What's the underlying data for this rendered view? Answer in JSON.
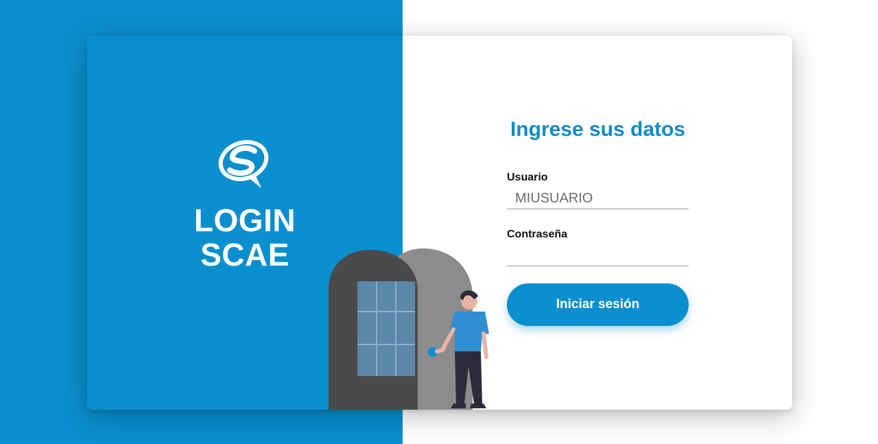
{
  "brand": {
    "title_line1": "LOGIN",
    "title_line2": "SCAE",
    "logo_icon": "scae-logo-icon"
  },
  "form": {
    "title": "Ingrese sus datos",
    "username": {
      "label": "Usuario",
      "placeholder": "MIUSUARIO",
      "value": "",
      "icon": "user-icon"
    },
    "password": {
      "label": "Contraseña",
      "placeholder": "",
      "value": "",
      "icon": "lock-icon"
    },
    "submit_label": "Iniciar sesión"
  },
  "colors": {
    "primary": "#0a8fce",
    "title": "#0b8ccb",
    "background": "#ffffff",
    "door_dark": "#4a4a4a",
    "door_frame": "#8c8c8c",
    "window": "#5b87a8"
  },
  "illustration": {
    "name": "person-at-door-illustration"
  }
}
